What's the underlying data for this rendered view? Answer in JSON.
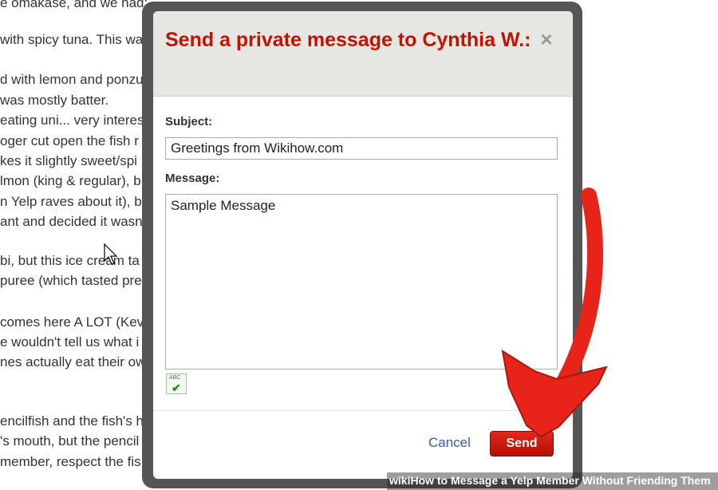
{
  "background_article": {
    "lines": [
      "e omakase, and we had:",
      "with spicy tuna. This wa",
      "d with lemon and ponzu",
      "was mostly batter.",
      "eating uni... very interes",
      "oger cut open the fish r",
      "kes it slightly sweet/spi",
      "lmon (king & regular), b",
      "n Yelp raves about it), bu",
      "ant and decided it wasn",
      "bi, but this ice cream ta",
      "puree (which tasted pre",
      "comes here A LOT (Kev",
      "e wouldn't tell us what i",
      "nes actually eat their ow",
      "encilfish and the fish's h",
      "'s mouth, but the pencil",
      "member, respect the fis"
    ]
  },
  "dialog": {
    "title": "Send a private message to Cynthia W.:",
    "close_symbol": "×",
    "subject_label": "Subject:",
    "subject_value": "Greetings from Wikihow.com",
    "message_label": "Message:",
    "message_value": "Sample Message",
    "spellcheck_text": "ABC",
    "spellcheck_mark": "✔",
    "cancel_label": "Cancel",
    "send_label": "Send"
  },
  "overlay": {
    "arrow_color": "#e8231a",
    "watermark": "wikiHow to Message a Yelp Member Without Friending Them"
  },
  "colors": {
    "title": "#c41200",
    "send_button": "#cc1a0c",
    "cancel_link": "#2f5ea8",
    "dialog_frame": "#555555"
  }
}
